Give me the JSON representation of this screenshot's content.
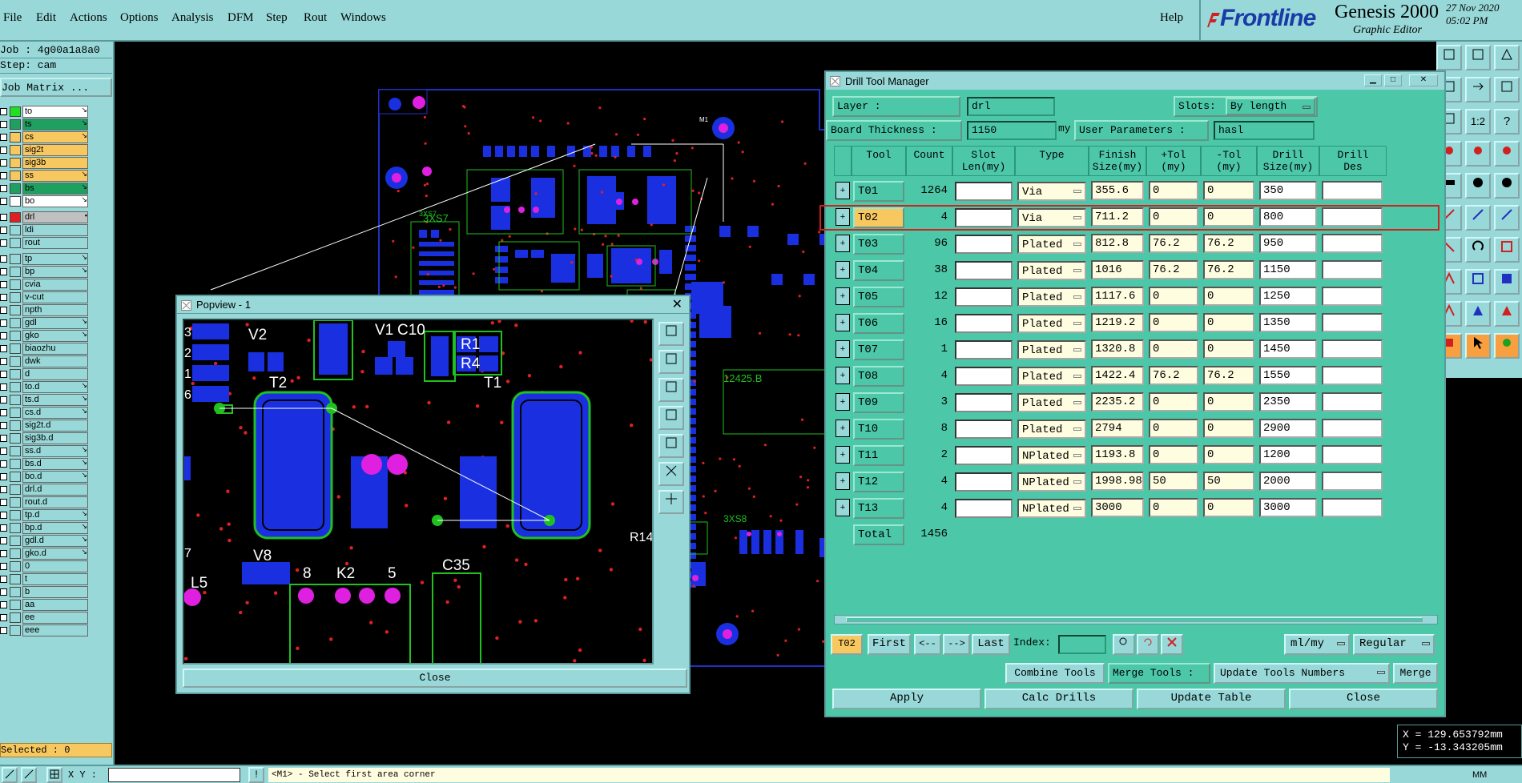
{
  "menu": {
    "items": [
      "File",
      "Edit",
      "Actions",
      "Options",
      "Analysis",
      "DFM",
      "Step",
      "Rout",
      "Windows"
    ],
    "help": "Help"
  },
  "logo": {
    "brand": "Frontline",
    "product": "Genesis 2000",
    "subtitle": "Graphic Editor",
    "date": "27 Nov 2020",
    "time": "05:02 PM"
  },
  "left": {
    "job": "Job : 4g00a1a8a0",
    "step": "Step: cam",
    "job_matrix": "Job Matrix ...",
    "layers": [
      {
        "name": "to",
        "color": "#20e020",
        "bg": "#ffffff",
        "mark": "↘"
      },
      {
        "name": "ts",
        "color": "#20a060",
        "bg": "#20a060",
        "mark": "↘"
      },
      {
        "name": "cs",
        "color": "#f8c860",
        "bg": "#f8c860",
        "mark": "↘"
      },
      {
        "name": "sig2t",
        "color": "#f8c860",
        "bg": "#f8c860",
        "mark": ""
      },
      {
        "name": "sig3b",
        "color": "#f8c860",
        "bg": "#f8c860",
        "mark": ""
      },
      {
        "name": "ss",
        "color": "#f8c860",
        "bg": "#f8c860",
        "mark": "↘"
      },
      {
        "name": "bs",
        "color": "#20a060",
        "bg": "#20a060",
        "mark": "↘"
      },
      {
        "name": "bo",
        "color": "#ffffff",
        "bg": "#ffffff",
        "mark": "↘"
      },
      {
        "name": "drl",
        "color": "#e02020",
        "bg": "#c0c0c0",
        "mark": "▪"
      },
      {
        "name": "ldi",
        "color": "#98d8d8",
        "bg": "#98d8d8",
        "mark": ""
      },
      {
        "name": "rout",
        "color": "#98d8d8",
        "bg": "#98d8d8",
        "mark": ""
      },
      {
        "name": "tp",
        "color": "#98d8d8",
        "bg": "#98d8d8",
        "mark": "↘"
      },
      {
        "name": "bp",
        "color": "#98d8d8",
        "bg": "#98d8d8",
        "mark": "↘"
      },
      {
        "name": "cvia",
        "color": "#98d8d8",
        "bg": "#98d8d8",
        "mark": ""
      },
      {
        "name": "v-cut",
        "color": "#98d8d8",
        "bg": "#98d8d8",
        "mark": ""
      },
      {
        "name": "npth",
        "color": "#98d8d8",
        "bg": "#98d8d8",
        "mark": ""
      },
      {
        "name": "gdl",
        "color": "#98d8d8",
        "bg": "#98d8d8",
        "mark": "↘"
      },
      {
        "name": "gko",
        "color": "#98d8d8",
        "bg": "#98d8d8",
        "mark": "↘"
      },
      {
        "name": "biaozhu",
        "color": "#98d8d8",
        "bg": "#98d8d8",
        "mark": ""
      },
      {
        "name": "dwk",
        "color": "#98d8d8",
        "bg": "#98d8d8",
        "mark": ""
      },
      {
        "name": "d",
        "color": "#98d8d8",
        "bg": "#98d8d8",
        "mark": ""
      },
      {
        "name": "to.d",
        "color": "#98d8d8",
        "bg": "#98d8d8",
        "mark": "↘"
      },
      {
        "name": "ts.d",
        "color": "#98d8d8",
        "bg": "#98d8d8",
        "mark": "↘"
      },
      {
        "name": "cs.d",
        "color": "#98d8d8",
        "bg": "#98d8d8",
        "mark": "↘"
      },
      {
        "name": "sig2t.d",
        "color": "#98d8d8",
        "bg": "#98d8d8",
        "mark": ""
      },
      {
        "name": "sig3b.d",
        "color": "#98d8d8",
        "bg": "#98d8d8",
        "mark": ""
      },
      {
        "name": "ss.d",
        "color": "#98d8d8",
        "bg": "#98d8d8",
        "mark": "↘"
      },
      {
        "name": "bs.d",
        "color": "#98d8d8",
        "bg": "#98d8d8",
        "mark": "↘"
      },
      {
        "name": "bo.d",
        "color": "#98d8d8",
        "bg": "#98d8d8",
        "mark": "↘"
      },
      {
        "name": "drl.d",
        "color": "#98d8d8",
        "bg": "#98d8d8",
        "mark": ""
      },
      {
        "name": "rout.d",
        "color": "#98d8d8",
        "bg": "#98d8d8",
        "mark": ""
      },
      {
        "name": "tp.d",
        "color": "#98d8d8",
        "bg": "#98d8d8",
        "mark": "↘"
      },
      {
        "name": "bp.d",
        "color": "#98d8d8",
        "bg": "#98d8d8",
        "mark": "↘"
      },
      {
        "name": "gdl.d",
        "color": "#98d8d8",
        "bg": "#98d8d8",
        "mark": "↘"
      },
      {
        "name": "gko.d",
        "color": "#98d8d8",
        "bg": "#98d8d8",
        "mark": "↘"
      },
      {
        "name": "0",
        "color": "#98d8d8",
        "bg": "#98d8d8",
        "mark": ""
      },
      {
        "name": "t",
        "color": "#98d8d8",
        "bg": "#98d8d8",
        "mark": ""
      },
      {
        "name": "b",
        "color": "#98d8d8",
        "bg": "#98d8d8",
        "mark": ""
      },
      {
        "name": "aa",
        "color": "#98d8d8",
        "bg": "#98d8d8",
        "mark": ""
      },
      {
        "name": "ee",
        "color": "#98d8d8",
        "bg": "#98d8d8",
        "mark": ""
      },
      {
        "name": "eee",
        "color": "#98d8d8",
        "bg": "#98d8d8",
        "mark": ""
      }
    ],
    "selected": "Selected : 0"
  },
  "bottom": {
    "xy_label": "X Y :",
    "status": "<M1> - Select first area corner",
    "unit": "MM"
  },
  "coords": {
    "x": "X = 129.653792mm",
    "y": "Y = -13.343205mm"
  },
  "pcb_labels": {
    "lbl1": "12425.B",
    "lbl2": "3XS8",
    "lbl3": "3XS7",
    "lbl4": "M1"
  },
  "popview": {
    "title": "Popview - 1",
    "close": "Close",
    "labels": [
      "V2",
      "V1",
      "C10",
      "R1",
      "R4",
      "T2",
      "T1",
      "V8",
      "L5",
      "8",
      "K2",
      "5",
      "C35",
      "R14",
      "3",
      "2",
      "1",
      "6",
      "7"
    ]
  },
  "dtm": {
    "title": "Drill Tool Manager",
    "layer_label": "Layer          :",
    "layer_value": "drl",
    "slots_label": "Slots:",
    "slots_value": "By length",
    "thickness_label": "Board Thickness :",
    "thickness_value": "1150",
    "thickness_unit": "my",
    "user_params_label": "User Parameters :",
    "user_params_value": "hasl",
    "columns": [
      "Tool",
      "Count",
      "Slot\nLen(my)",
      "Type",
      "Finish\nSize(my)",
      "+Tol\n(my)",
      "-Tol\n(my)",
      "Drill\nSize(my)",
      "Drill\nDes"
    ],
    "rows": [
      {
        "tool": "T01",
        "count": "1264",
        "type": "Via",
        "finish": "355.6",
        "ptol": "0",
        "mtol": "0",
        "drill": "350"
      },
      {
        "tool": "T02",
        "count": "4",
        "type": "Via",
        "finish": "711.2",
        "ptol": "0",
        "mtol": "0",
        "drill": "800"
      },
      {
        "tool": "T03",
        "count": "96",
        "type": "Plated",
        "finish": "812.8",
        "ptol": "76.2",
        "mtol": "76.2",
        "drill": "950"
      },
      {
        "tool": "T04",
        "count": "38",
        "type": "Plated",
        "finish": "1016",
        "ptol": "76.2",
        "mtol": "76.2",
        "drill": "1150"
      },
      {
        "tool": "T05",
        "count": "12",
        "type": "Plated",
        "finish": "1117.6",
        "ptol": "0",
        "mtol": "0",
        "drill": "1250"
      },
      {
        "tool": "T06",
        "count": "16",
        "type": "Plated",
        "finish": "1219.2",
        "ptol": "0",
        "mtol": "0",
        "drill": "1350"
      },
      {
        "tool": "T07",
        "count": "1",
        "type": "Plated",
        "finish": "1320.8",
        "ptol": "0",
        "mtol": "0",
        "drill": "1450"
      },
      {
        "tool": "T08",
        "count": "4",
        "type": "Plated",
        "finish": "1422.4",
        "ptol": "76.2",
        "mtol": "76.2",
        "drill": "1550"
      },
      {
        "tool": "T09",
        "count": "3",
        "type": "Plated",
        "finish": "2235.2",
        "ptol": "0",
        "mtol": "0",
        "drill": "2350"
      },
      {
        "tool": "T10",
        "count": "8",
        "type": "Plated",
        "finish": "2794",
        "ptol": "0",
        "mtol": "0",
        "drill": "2900"
      },
      {
        "tool": "T11",
        "count": "2",
        "type": "NPlated",
        "finish": "1193.8",
        "ptol": "0",
        "mtol": "0",
        "drill": "1200"
      },
      {
        "tool": "T12",
        "count": "4",
        "type": "NPlated",
        "finish": "1998.98",
        "ptol": "50",
        "mtol": "50",
        "drill": "2000"
      },
      {
        "tool": "T13",
        "count": "4",
        "type": "NPlated",
        "finish": "3000",
        "ptol": "0",
        "mtol": "0",
        "drill": "3000"
      }
    ],
    "total_label": "Total",
    "total_value": "1456",
    "current_tool": "T02",
    "nav_first": "First",
    "nav_prev": "<--",
    "nav_next": "-->",
    "nav_last": "Last",
    "index_label": "Index:",
    "unit_select": "ml/my",
    "mode_select": "Regular",
    "combine_tools": "Combine Tools",
    "merge_tools_label": "Merge Tools :",
    "merge_select": "Update Tools Numbers",
    "merge": "Merge",
    "apply": "Apply",
    "calc_drills": "Calc Drills",
    "update_table": "Update Table",
    "close": "Close"
  }
}
